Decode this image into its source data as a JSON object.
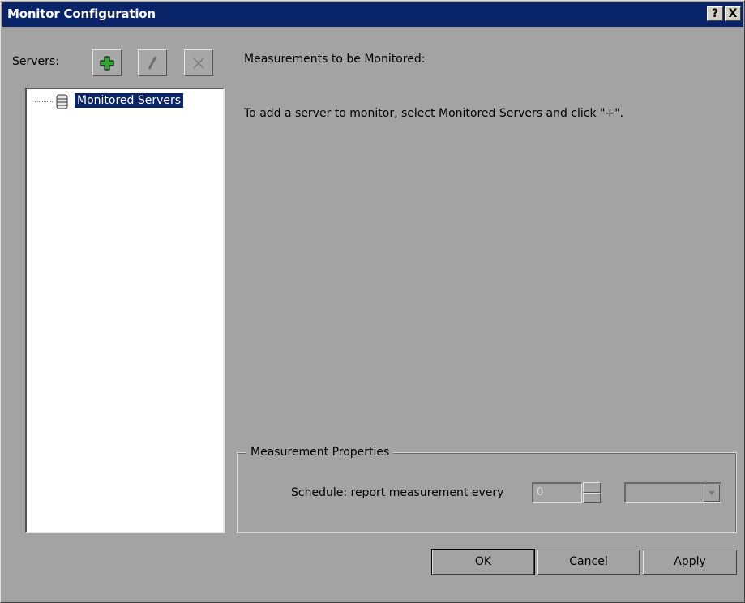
{
  "window": {
    "title": "Monitor Configuration"
  },
  "titlebar_buttons": {
    "help": "?",
    "close": "X"
  },
  "servers": {
    "label": "Servers:"
  },
  "toolbar": {
    "add": {
      "icon": "plus-icon",
      "enabled": true,
      "color": "#2fa82f"
    },
    "edit": {
      "icon": "pencil-icon",
      "enabled": false
    },
    "delete": {
      "icon": "x-icon",
      "enabled": false
    }
  },
  "tree": {
    "items": [
      {
        "label": "Monitored Servers",
        "icon": "server-database-icon",
        "selected": true
      }
    ]
  },
  "measurements": {
    "title": "Measurements to be Monitored:",
    "hint": "To add a server to monitor, select Monitored Servers and click \"+\"."
  },
  "properties": {
    "legend": "Measurement Properties",
    "schedule_label": "Schedule: report measurement every",
    "interval_value": "0",
    "unit_value": ""
  },
  "buttons": {
    "ok": "OK",
    "cancel": "Cancel",
    "apply": "Apply"
  },
  "colors": {
    "titlebar": "#0a246a",
    "background": "#a3a3a3",
    "selection": "#0a246a"
  }
}
